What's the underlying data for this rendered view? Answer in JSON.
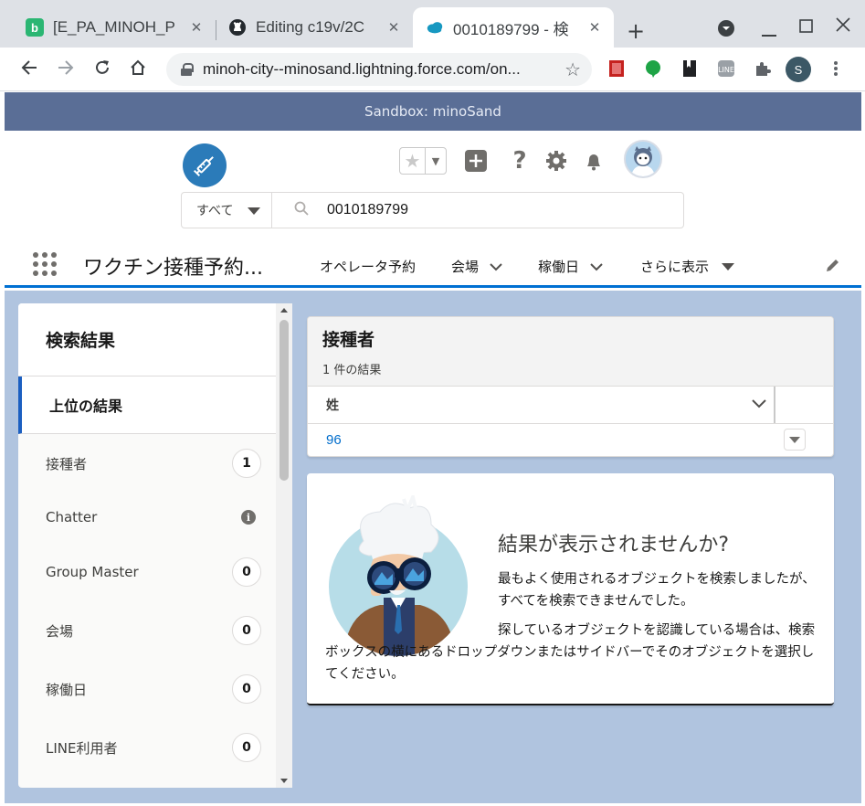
{
  "browser": {
    "tabs": [
      {
        "title": "[E_PA_MINOH_P",
        "icon": "b-app-icon"
      },
      {
        "title": "Editing c19v/2C",
        "icon": "github-icon"
      },
      {
        "title": "0010189799 - 検",
        "icon": "salesforce-cloud-icon"
      }
    ],
    "url": "minoh-city--minosand.lightning.force.com/on...",
    "profile_initial": "S"
  },
  "sandbox_banner": "Sandbox: minoSand",
  "search": {
    "scope": "すべて",
    "query": "0010189799"
  },
  "nav": {
    "app_name": "ワクチン接種予約...",
    "items": [
      "オペレータ予約",
      "会場",
      "稼働日",
      "さらに表示"
    ]
  },
  "sidebar": {
    "title": "検索結果",
    "top_result": "上位の結果",
    "items": [
      {
        "label": "接種者",
        "count": "1"
      },
      {
        "label": "Chatter",
        "count": "i"
      },
      {
        "label": "Group Master",
        "count": "0"
      },
      {
        "label": "会場",
        "count": "0"
      },
      {
        "label": "稼働日",
        "count": "0"
      },
      {
        "label": "LINE利用者",
        "count": "0"
      }
    ]
  },
  "results": {
    "title": "接種者",
    "subtitle": "1 件の結果",
    "column": "姓",
    "rows": [
      "96"
    ]
  },
  "empty_state": {
    "title": "結果が表示されませんか?",
    "p1": "最もよく使用されるオブジェクトを検索しましたが、すべてを検索できませんでした。",
    "p2": "探しているオブジェクトを認識している場合は、検索ボックスの横にあるドロップダウンまたはサイドバーでそのオブジェクトを選択してください。"
  },
  "colors": {
    "brand": "#0070d2",
    "sandbox_banner": "#5a6e96",
    "page_bg": "#b0c4df",
    "link": "#006dcc"
  }
}
